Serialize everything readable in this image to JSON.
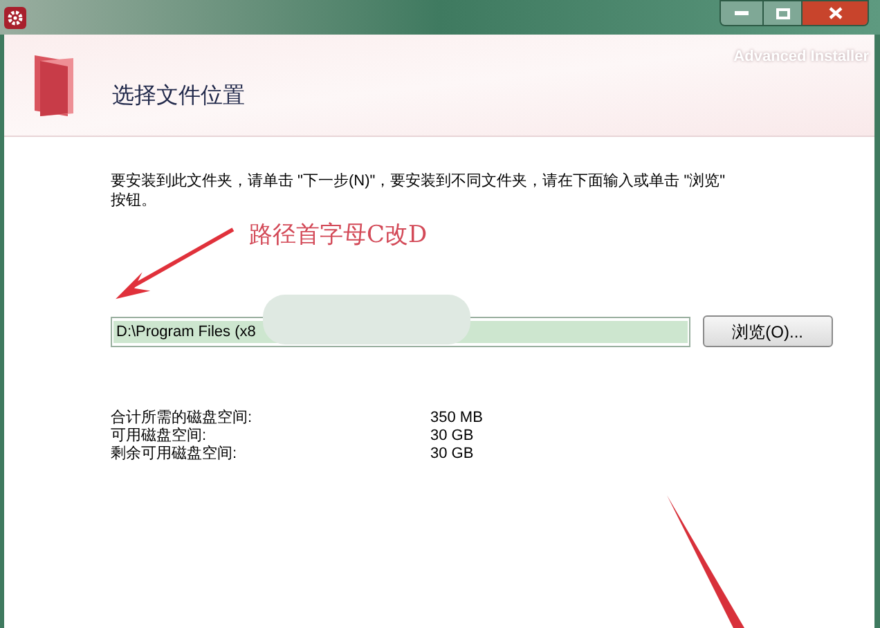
{
  "header": {
    "title": "选择文件位置",
    "brand": "Advanced Installer"
  },
  "instruction": "要安装到此文件夹，请单击 \"下一步(N)\"，要安装到不同文件夹，请在下面输入或单击 \"浏览\" 按钮。",
  "annotation": {
    "text": "路径首字母C改D"
  },
  "path_field": {
    "value": "D:\\Program Files (x8"
  },
  "browse_button": "浏览(O)...",
  "disk_space": [
    {
      "label": "合计所需的磁盘空间:",
      "value": "350 MB"
    },
    {
      "label": "可用磁盘空间:",
      "value": "30 GB"
    },
    {
      "label": "剩余可用磁盘空间:",
      "value": "30 GB"
    }
  ]
}
